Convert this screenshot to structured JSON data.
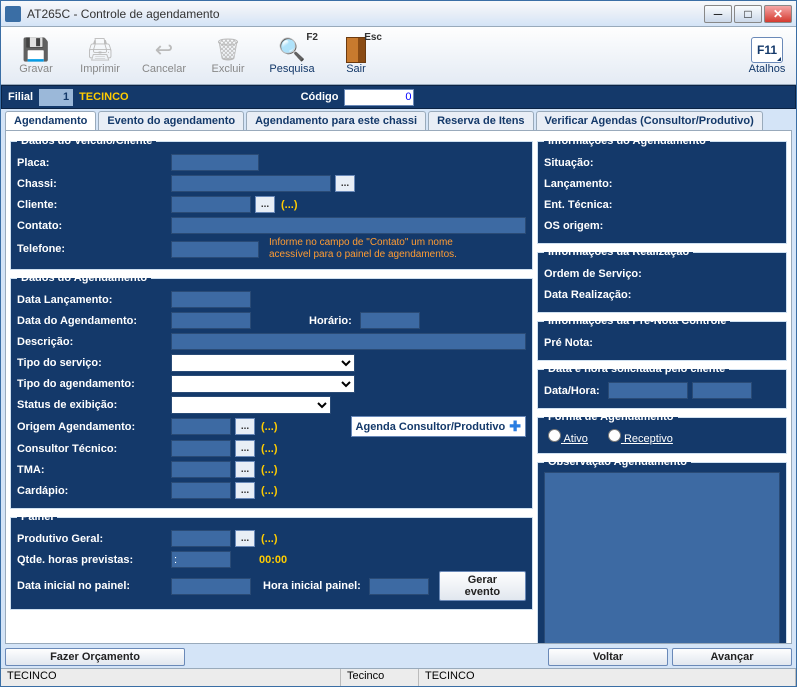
{
  "window": {
    "title": "AT265C - Controle de agendamento"
  },
  "toolbar": {
    "gravar": "Gravar",
    "imprimir": "Imprimir",
    "cancelar": "Cancelar",
    "excluir": "Excluir",
    "pesquisa": "Pesquisa",
    "pesquisa_key": "F2",
    "sair": "Sair",
    "sair_key": "Esc",
    "atalhos": "Atalhos",
    "atalhos_key": "F11"
  },
  "infobar": {
    "filial_label": "Filial",
    "filial_num": "1",
    "filial_name": "TECINCO",
    "codigo_label": "Código",
    "codigo_value": "0"
  },
  "tabs": {
    "agendamento": "Agendamento",
    "evento": "Evento do agendamento",
    "chassi": "Agendamento para este chassi",
    "reserva": "Reserva de Itens",
    "verificar": "Verificar Agendas (Consultor/Produtivo)"
  },
  "fs_veiculo": {
    "legend": "Dados do Veículo/Cliente",
    "placa": "Placa:",
    "chassi": "Chassi:",
    "cliente": "Cliente:",
    "contato": "Contato:",
    "telefone": "Telefone:",
    "hint1": "Informe no campo de \"Contato\" um nome",
    "hint2": "acessível para o painel de agendamentos.",
    "paren": "(...)"
  },
  "fs_agend": {
    "legend": "Dados do Agendamento",
    "data_lanc": "Data Lançamento:",
    "data_agend": "Data do Agendamento:",
    "horario": "Horário:",
    "descricao": "Descrição:",
    "tipo_serv": "Tipo do serviço:",
    "tipo_agend": "Tipo do agendamento:",
    "status": "Status de exibição:",
    "origem": "Origem Agendamento:",
    "consultor": "Consultor Técnico:",
    "tma": "TMA:",
    "cardapio": "Cardápio:",
    "btn_agenda": "Agenda Consultor/Produtivo",
    "paren": "(...)"
  },
  "fs_painel": {
    "legend": "Painel",
    "prod_geral": "Produtivo Geral:",
    "qtde": "Qtde. horas previstas:",
    "qtde_val": ":",
    "qtde_time": "00:00",
    "data_ini": "Data inicial no painel:",
    "hora_ini": "Hora inicial painel:",
    "gerar": "Gerar evento",
    "paren": "(...)"
  },
  "fs_info_ag": {
    "legend": "Informações do Agendamento",
    "sit": "Situação:",
    "lanc": "Lançamento:",
    "ent": "Ent. Técnica:",
    "os": "OS origem:"
  },
  "fs_info_real": {
    "legend": "Informações da Realização",
    "os": "Ordem de Serviço:",
    "data": "Data Realização:"
  },
  "fs_pre": {
    "legend": "Informações da Pré-Nota Controle",
    "pre": "Pré Nota:"
  },
  "fs_dh": {
    "legend": "Data e hora solicitada pelo cliente",
    "label": "Data/Hora:"
  },
  "fs_forma": {
    "legend": "Forma de Agendamento",
    "ativo": "Ativo",
    "receptivo": "Receptivo"
  },
  "fs_obs": {
    "legend": "Observação Agendamento"
  },
  "bottom": {
    "orcamento": "Fazer Orçamento",
    "voltar": "Voltar",
    "avancar": "Avançar"
  },
  "status": {
    "c1": "TECINCO",
    "c2": "Tecinco",
    "c3": "TECINCO"
  }
}
